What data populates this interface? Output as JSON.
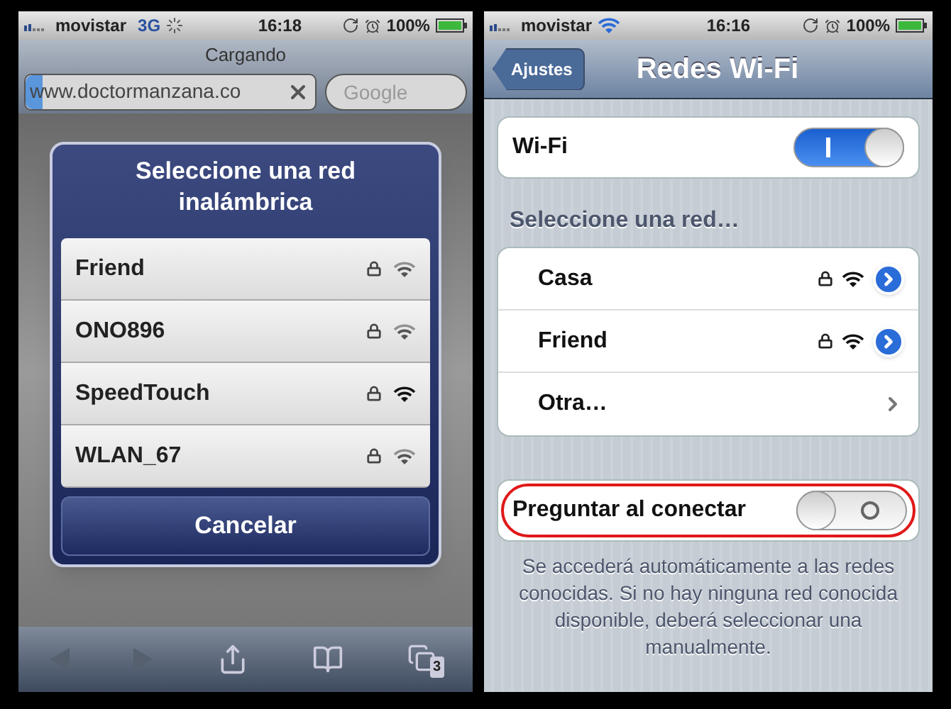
{
  "left_phone": {
    "status_bar": {
      "carrier": "movistar",
      "network": "3G",
      "time": "16:18",
      "battery": "100%"
    },
    "browser": {
      "title": "Cargando",
      "url": "www.doctormanzana.co",
      "loading": true,
      "search_placeholder": "Google"
    },
    "dialog": {
      "title": "Seleccione una red inalámbrica",
      "networks": [
        {
          "name": "Friend",
          "locked": true,
          "strong": false
        },
        {
          "name": "ONO896",
          "locked": true,
          "strong": false
        },
        {
          "name": "SpeedTouch",
          "locked": true,
          "strong": true
        },
        {
          "name": "WLAN_67",
          "locked": true,
          "strong": false
        }
      ],
      "cancel": "Cancelar"
    },
    "toolbar": {
      "tab_count": "3"
    }
  },
  "right_phone": {
    "status_bar": {
      "carrier": "movistar",
      "time": "16:16",
      "battery": "100%"
    },
    "nav_bar": {
      "back": "Ajustes",
      "title": "Redes Wi-Fi"
    },
    "wifi": {
      "label": "Wi-Fi",
      "on": true
    },
    "section_header": "Seleccione una red…",
    "networks": [
      {
        "kind": "network",
        "name": "Casa",
        "locked": true
      },
      {
        "kind": "network",
        "name": "Friend",
        "locked": true
      },
      {
        "kind": "other",
        "name": "Otra…"
      }
    ],
    "ask": {
      "label": "Preguntar al conectar",
      "on": false,
      "highlighted": true
    },
    "footer": "Se accederá automáticamente a las redes conocidas. Si no hay ninguna red conocida disponible, deberá seleccionar una manualmente."
  }
}
